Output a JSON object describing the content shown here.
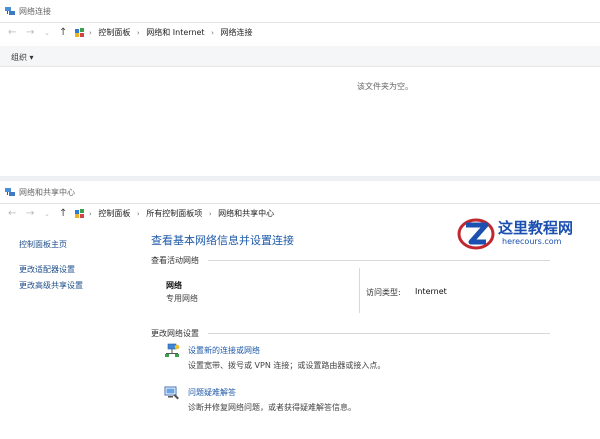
{
  "window1": {
    "title": "网络连接",
    "breadcrumb": [
      "控制面板",
      "网络和 Internet",
      "网络连接"
    ],
    "organize_label": "组织 ▾",
    "empty_message": "该文件夹为空。"
  },
  "window2": {
    "title": "网络和共享中心",
    "breadcrumb": [
      "控制面板",
      "所有控制面板项",
      "网络和共享中心"
    ],
    "sidebar": {
      "home": "控制面板主页",
      "change_adapter": "更改适配器设置",
      "change_sharing": "更改高级共享设置"
    },
    "main_title": "查看基本网络信息并设置连接",
    "active_section": "查看活动网络",
    "network": {
      "name": "网络",
      "profile": "专用网络",
      "access_label": "访问类型:",
      "access_value": "Internet"
    },
    "change_section": "更改网络设置",
    "tasks": [
      {
        "title": "设置新的连接或网络",
        "desc": "设置宽带、拨号或 VPN 连接；或设置路由器或接入点。",
        "icon": "network-setup-icon"
      },
      {
        "title": "问题疑难解答",
        "desc": "诊断并修复网络问题，或者获得疑难解答信息。",
        "icon": "troubleshoot-icon"
      }
    ]
  },
  "watermark": {
    "title": "这里教程网",
    "url": "herecours.com"
  },
  "colors": {
    "link": "#1e5aa8",
    "sidebar_link": "#1f4f8a",
    "watermark": "#1b4fb0",
    "watermark_accent": "#c0282d"
  }
}
